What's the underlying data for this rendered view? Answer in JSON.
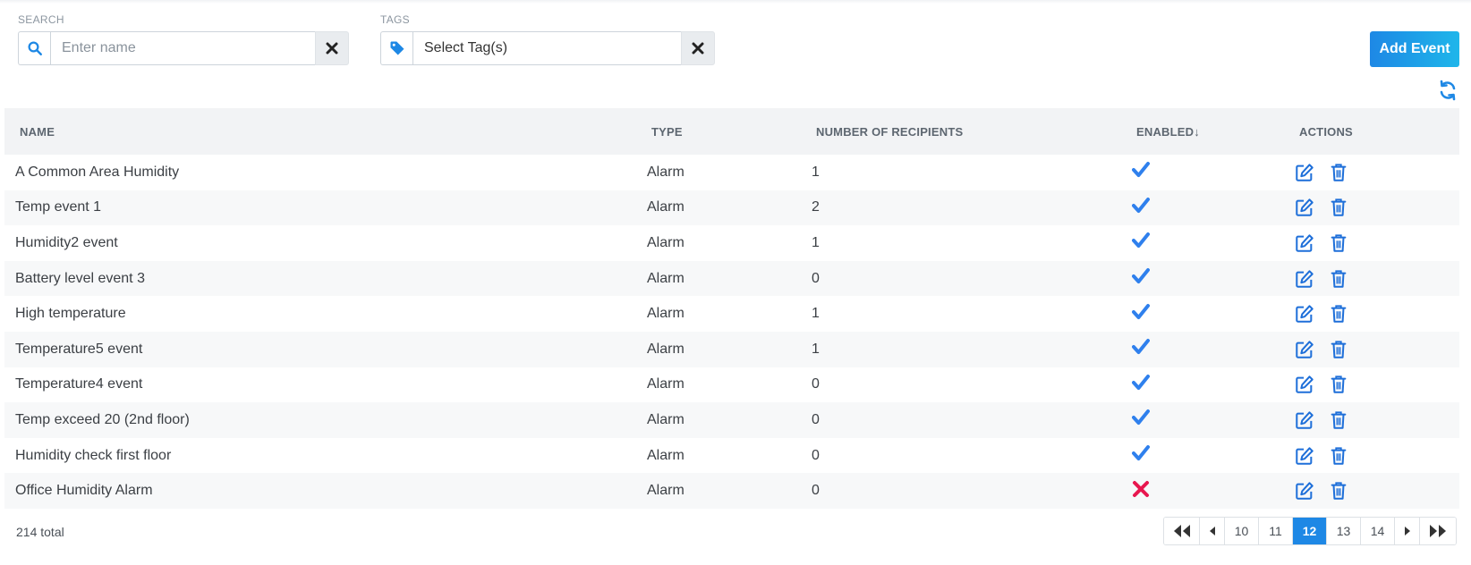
{
  "filters": {
    "search_label": "SEARCH",
    "search_placeholder": "Enter name",
    "search_value": "",
    "tags_label": "TAGS",
    "tags_value": "Select Tag(s)"
  },
  "toolbar": {
    "add_label": "Add Event"
  },
  "table": {
    "columns": [
      "NAME",
      "TYPE",
      "NUMBER OF RECIPIENTS",
      "ENABLED↓",
      "ACTIONS"
    ],
    "rows": [
      {
        "name": "A Common Area Humidity",
        "type": "Alarm",
        "recipients": "1",
        "enabled": true
      },
      {
        "name": "Temp event 1",
        "type": "Alarm",
        "recipients": "2",
        "enabled": true
      },
      {
        "name": "Humidity2 event",
        "type": "Alarm",
        "recipients": "1",
        "enabled": true
      },
      {
        "name": "Battery level event 3",
        "type": "Alarm",
        "recipients": "0",
        "enabled": true
      },
      {
        "name": "High temperature",
        "type": "Alarm",
        "recipients": "1",
        "enabled": true
      },
      {
        "name": "Temperature5 event",
        "type": "Alarm",
        "recipients": "1",
        "enabled": true
      },
      {
        "name": "Temperature4 event",
        "type": "Alarm",
        "recipients": "0",
        "enabled": true
      },
      {
        "name": "Temp exceed 20 (2nd floor)",
        "type": "Alarm",
        "recipients": "0",
        "enabled": true
      },
      {
        "name": "Humidity check first floor",
        "type": "Alarm",
        "recipients": "0",
        "enabled": true
      },
      {
        "name": "Office Humidity Alarm",
        "type": "Alarm",
        "recipients": "0",
        "enabled": false
      }
    ]
  },
  "footer": {
    "total": "214 total",
    "pages": [
      "10",
      "11",
      "12",
      "13",
      "14"
    ],
    "current_page": "12"
  },
  "colors": {
    "accent": "#1e88e5",
    "check": "#2f80ed",
    "cross": "#e8174f",
    "action_icon": "#1e6fd9"
  },
  "icons": {
    "search": "search-icon",
    "tag": "tag-icon",
    "clear": "close-icon",
    "refresh": "refresh-icon",
    "enabled": "checkmark-icon",
    "disabled": "cross-icon",
    "edit": "edit-icon",
    "delete": "trash-icon",
    "first": "double-chevron-left-icon",
    "prev": "chevron-left-icon",
    "next": "chevron-right-icon",
    "last": "double-chevron-right-icon"
  }
}
